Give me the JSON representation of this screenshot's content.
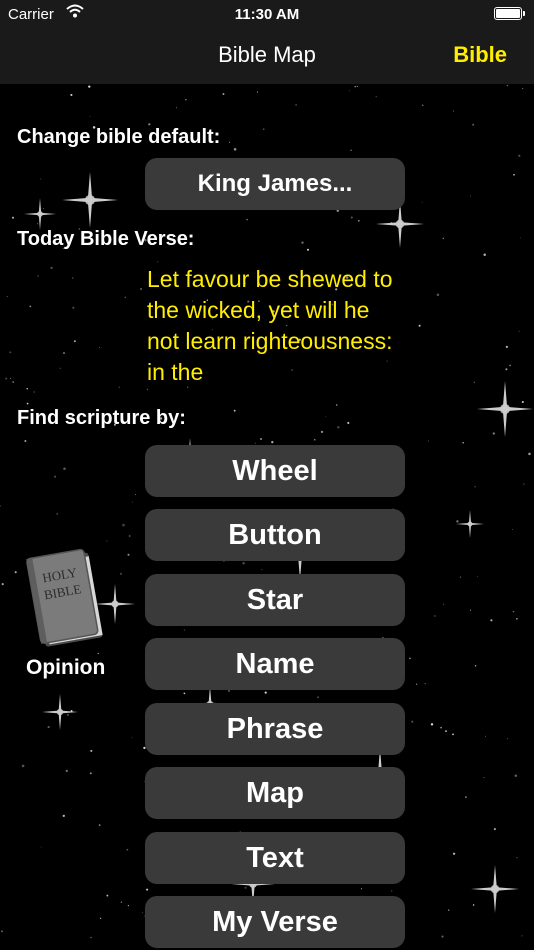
{
  "status_bar": {
    "carrier": "Carrier",
    "time": "11:30 AM",
    "battery_level": 1.0
  },
  "nav": {
    "title": "Bible Map",
    "right_button": "Bible"
  },
  "labels": {
    "change_default": "Change bible default:",
    "today_verse": "Today Bible Verse:",
    "find_by": "Find scripture by:"
  },
  "default_bible": "King James...",
  "verse_text": "Let favour be shewed to the wicked, yet will he not learn righteousness: in the",
  "find_buttons": [
    "Wheel",
    "Button",
    "Star",
    "Name",
    "Phrase",
    "Map",
    "Text",
    "My Verse"
  ],
  "book": {
    "cover_text": [
      "HOLY",
      "BIBLE"
    ],
    "caption": "Opinion"
  },
  "colors": {
    "accent_yellow": "#ffee00",
    "button_bg": "#3a3a3a",
    "bar_bg": "#1a1a1a"
  }
}
